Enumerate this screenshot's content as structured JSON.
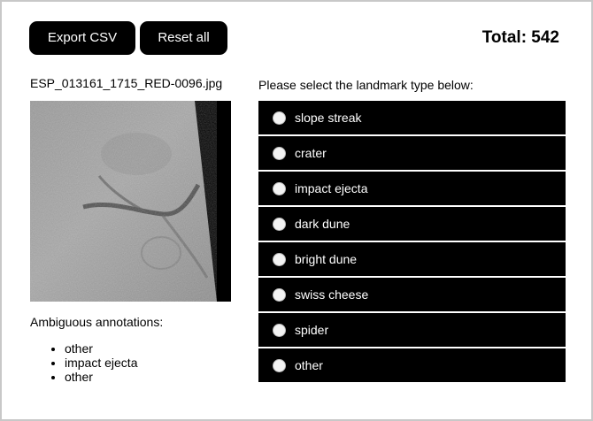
{
  "toolbar": {
    "export_label": "Export CSV",
    "reset_label": "Reset all"
  },
  "total_label": "Total: 542",
  "image": {
    "filename": "ESP_013161_1715_RED-0096.jpg"
  },
  "prompt": "Please select the landmark type below:",
  "options": [
    {
      "label": "slope streak"
    },
    {
      "label": "crater"
    },
    {
      "label": "impact ejecta"
    },
    {
      "label": "dark dune"
    },
    {
      "label": "bright dune"
    },
    {
      "label": "swiss cheese"
    },
    {
      "label": "spider"
    },
    {
      "label": "other"
    }
  ],
  "ambiguous": {
    "label": "Ambiguous annotations:",
    "items": [
      "other",
      "impact ejecta",
      "other"
    ]
  }
}
